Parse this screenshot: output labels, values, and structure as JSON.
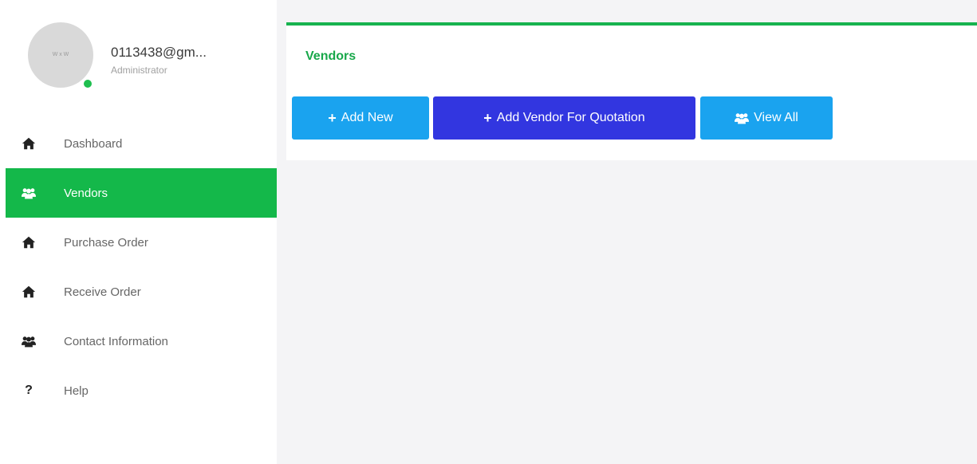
{
  "profile": {
    "email": "0113438@gm...",
    "role": "Administrator",
    "avatar_initials": "W x W"
  },
  "sidebar": {
    "items": [
      {
        "label": "Dashboard",
        "icon": "home-icon",
        "active": false
      },
      {
        "label": "Vendors",
        "icon": "users-icon",
        "active": true
      },
      {
        "label": "Purchase Order",
        "icon": "home-icon",
        "active": false
      },
      {
        "label": "Receive Order",
        "icon": "home-icon",
        "active": false
      },
      {
        "label": "Contact Information",
        "icon": "users-icon",
        "active": false
      },
      {
        "label": "Help",
        "icon": "question-icon",
        "active": false
      }
    ]
  },
  "main": {
    "title": "Vendors",
    "buttons": {
      "add_new": "Add New",
      "add_vendor_quotation": "Add Vendor For Quotation",
      "view_all": "View All"
    }
  },
  "colors": {
    "accent_green": "#14b84a",
    "button_blue": "#1aa3ef",
    "button_indigo": "#3236e0"
  }
}
